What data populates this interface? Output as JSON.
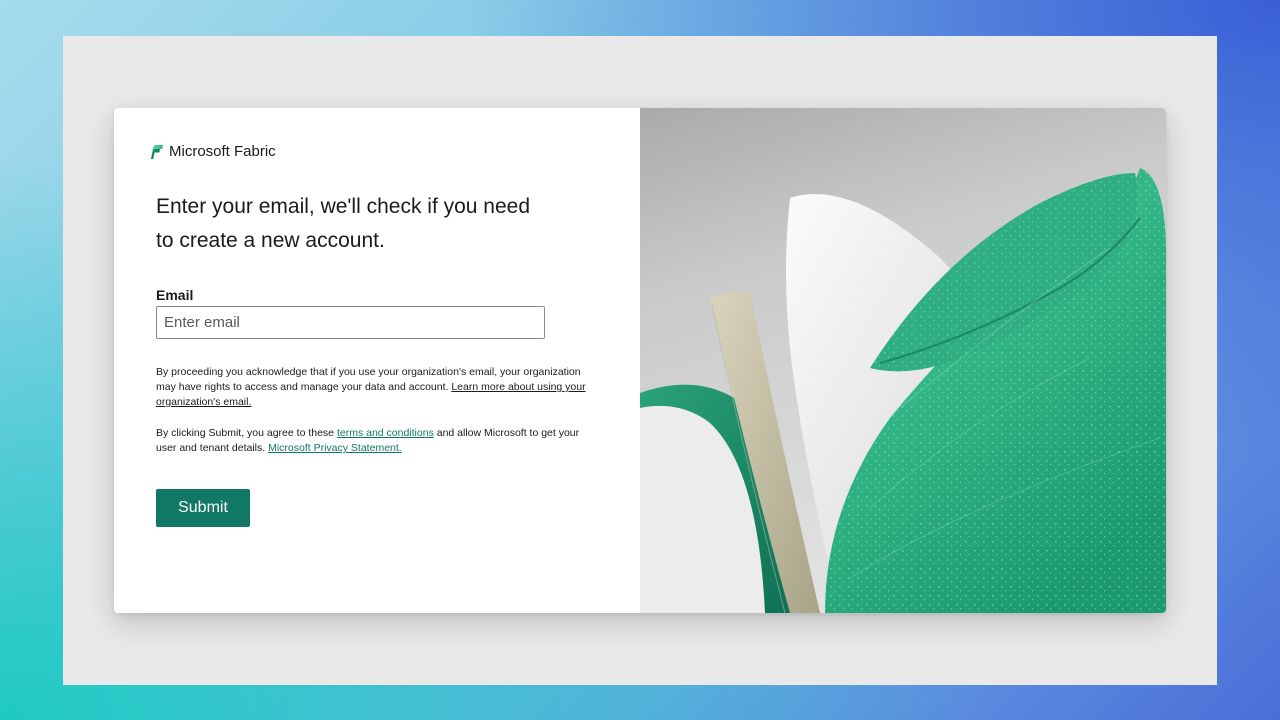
{
  "brand": {
    "name": "Microsoft Fabric",
    "logo_icon": "microsoft-fabric-logo",
    "accent_color": "#117865"
  },
  "form": {
    "heading_line1": "Enter your email, we'll check if you need",
    "heading_line2": "to create a new account.",
    "email_label": "Email",
    "email_placeholder": "Enter email",
    "email_value": "",
    "notice": {
      "text": "By proceeding you acknowledge that if you use your organization's email, your organization may have rights to access and manage your data and account. ",
      "link": "Learn more about using your organization's email."
    },
    "consent": {
      "text_before": "By clicking Submit, you agree to these ",
      "terms_link": "terms and conditions",
      "text_middle": " and allow Microsoft to get your user and tenant details. ",
      "privacy_link": "Microsoft Privacy Statement."
    },
    "submit_label": "Submit"
  },
  "hero": {
    "image_icon": "fabric-leaf-illustration"
  }
}
